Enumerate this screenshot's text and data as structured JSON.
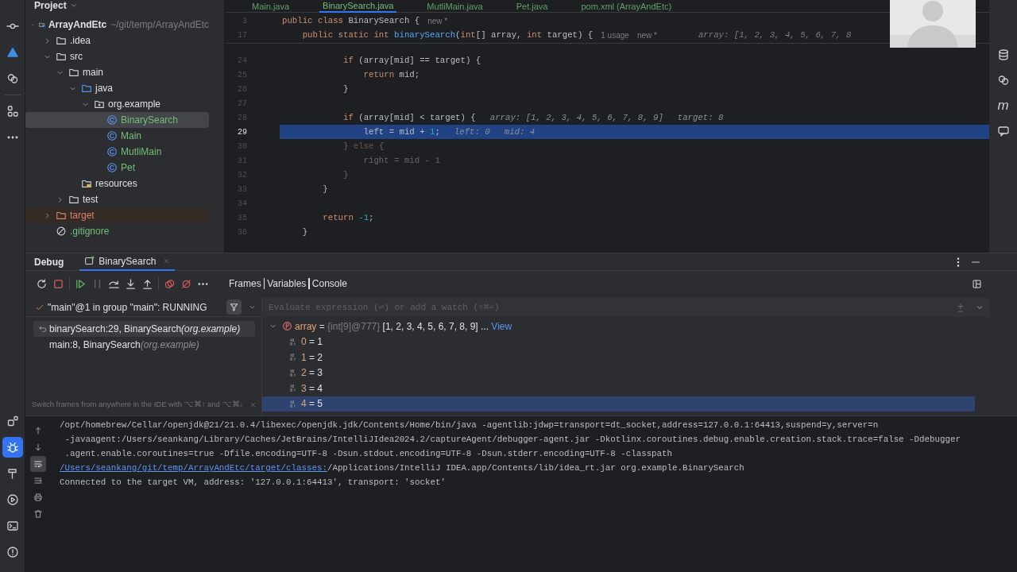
{
  "left_toolbar": {
    "top": [
      {
        "kind": "commit",
        "selected": false
      },
      {
        "kind": "triangle",
        "selected": false
      },
      {
        "kind": "circles",
        "selected": false
      },
      {
        "kind": "squares",
        "selected": false
      },
      {
        "kind": "more",
        "selected": false
      }
    ],
    "bottom": [
      {
        "kind": "plugins",
        "selected": false
      },
      {
        "kind": "bug",
        "selected": true
      },
      {
        "kind": "hammer",
        "selected": false
      },
      {
        "kind": "play",
        "selected": false
      },
      {
        "kind": "terminal",
        "selected": false
      },
      {
        "kind": "warning",
        "selected": false
      }
    ]
  },
  "project": {
    "title": "Project",
    "tree": [
      {
        "label": "ArrayAndEtc",
        "hint": "~/git/temp/ArrayAndEtc",
        "kind": "module",
        "color": "#dfe1e5",
        "selected": false,
        "expanded": true,
        "children": [
          {
            "label": ".idea",
            "kind": "folder",
            "color": "#dfe1e5",
            "selected": false,
            "expanded": false
          },
          {
            "label": "src",
            "kind": "folder",
            "color": "#dfe1e5",
            "selected": false,
            "expanded": true,
            "children": [
              {
                "label": "main",
                "kind": "folder",
                "color": "#dfe1e5",
                "selected": false,
                "expanded": true,
                "children": [
                  {
                    "label": "java",
                    "kind": "source",
                    "color": "#dfe1e5",
                    "selected": false,
                    "expanded": true,
                    "children": [
                      {
                        "label": "org.example",
                        "kind": "package",
                        "color": "#dfe1e5",
                        "selected": false,
                        "expanded": true,
                        "children": [
                          {
                            "label": "BinarySearch",
                            "kind": "class",
                            "color": "#73bd79",
                            "selected": true
                          },
                          {
                            "label": "Main",
                            "kind": "class",
                            "color": "#73bd79",
                            "selected": false
                          },
                          {
                            "label": "MutliMain",
                            "kind": "class",
                            "color": "#73bd79",
                            "selected": false
                          },
                          {
                            "label": "Pet",
                            "kind": "class",
                            "color": "#73bd79",
                            "selected": false
                          }
                        ]
                      }
                    ]
                  },
                  {
                    "label": "resources",
                    "kind": "resources",
                    "color": "#dfe1e5",
                    "selected": false
                  }
                ]
              },
              {
                "label": "test",
                "kind": "folder",
                "color": "#dfe1e5",
                "selected": false,
                "expanded": false
              }
            ]
          },
          {
            "label": "target",
            "kind": "excluded",
            "color": "#d9826a",
            "selected": false,
            "expanded": false
          },
          {
            "label": ".gitignore",
            "kind": "ignore",
            "color": "#73bd79",
            "selected": false
          }
        ]
      }
    ]
  },
  "editor": {
    "tabs": [
      {
        "label": "Main.java",
        "selected": false
      },
      {
        "label": "BinarySearch.java",
        "selected": true
      },
      {
        "label": "MutliMain.java",
        "selected": false
      },
      {
        "label": "Pet.java",
        "selected": false
      },
      {
        "label": "pom.xml (ArrayAndEtc)",
        "selected": false
      }
    ],
    "sticky_lines": [
      {
        "number": "3",
        "segments": [
          {
            "kind": "kw",
            "text": "public class "
          },
          {
            "kind": "plain",
            "text": "BinarySearch {"
          }
        ],
        "hints": [
          {
            "kind": "usage",
            "text": "new *"
          }
        ]
      },
      {
        "number": "17",
        "segments": [
          {
            "kind": "kw",
            "text": "    public static int "
          },
          {
            "kind": "fn",
            "text": "binarySearch"
          },
          {
            "kind": "plain",
            "text": "("
          },
          {
            "kind": "kw",
            "text": "int"
          },
          {
            "kind": "plain",
            "text": "[] array, "
          },
          {
            "kind": "kw",
            "text": "int "
          },
          {
            "kind": "plain",
            "text": "target) {"
          }
        ],
        "hints": [
          {
            "kind": "usage",
            "text": "1 usage"
          },
          {
            "kind": "usage",
            "text": "new *"
          },
          {
            "kind": "far",
            "text": "array: [1, 2, 3, 4, 5, 6, 7, 8"
          }
        ]
      }
    ],
    "lines": [
      {
        "number": "24",
        "current": false,
        "dimmed": false,
        "segments": [
          {
            "kind": "kw",
            "text": "            if "
          },
          {
            "kind": "plain",
            "text": "(array[mid] == target) {"
          }
        ]
      },
      {
        "number": "25",
        "current": false,
        "dimmed": false,
        "segments": [
          {
            "kind": "kw",
            "text": "                return "
          },
          {
            "kind": "plain",
            "text": "mid;"
          }
        ]
      },
      {
        "number": "26",
        "current": false,
        "dimmed": false,
        "segments": [
          {
            "kind": "plain",
            "text": "            }"
          }
        ]
      },
      {
        "number": "27",
        "current": false
      },
      {
        "number": "28",
        "current": false,
        "dimmed": false,
        "segments": [
          {
            "kind": "kw",
            "text": "            if "
          },
          {
            "kind": "plain",
            "text": "(array[mid] < target) {"
          }
        ],
        "hints": [
          {
            "kind": "value",
            "text": "array: [1, 2, 3, 4, 5, 6, 7, 8, 9]"
          },
          {
            "kind": "value",
            "text": "target: 8"
          }
        ]
      },
      {
        "number": "29",
        "current": true,
        "dimmed": false,
        "segments": [
          {
            "kind": "plain",
            "text": "                left = mid + "
          },
          {
            "kind": "num",
            "text": "1"
          },
          {
            "kind": "plain",
            "text": ";"
          }
        ],
        "hints": [
          {
            "kind": "value",
            "text": "left: 0"
          },
          {
            "kind": "value",
            "text": "mid: 4"
          }
        ]
      },
      {
        "number": "30",
        "current": false,
        "dimmed": true,
        "segments": [
          {
            "kind": "plain",
            "text": "            } "
          },
          {
            "kind": "kw",
            "text": "else "
          },
          {
            "kind": "plain",
            "text": "{"
          }
        ]
      },
      {
        "number": "31",
        "current": false,
        "dimmed": true,
        "segments": [
          {
            "kind": "plain",
            "text": "                right = mid - 1"
          }
        ]
      },
      {
        "number": "32",
        "current": false,
        "dimmed": true,
        "segments": [
          {
            "kind": "plain",
            "text": "            }"
          }
        ]
      },
      {
        "number": "33",
        "current": false,
        "dimmed": false,
        "segments": [
          {
            "kind": "plain",
            "text": "        }"
          }
        ]
      },
      {
        "number": "34",
        "current": false
      },
      {
        "number": "35",
        "current": false,
        "dimmed": false,
        "segments": [
          {
            "kind": "kw",
            "text": "        return "
          },
          {
            "kind": "num",
            "text": "-1"
          },
          {
            "kind": "plain",
            "text": ";"
          }
        ]
      },
      {
        "number": "36",
        "current": false,
        "dimmed": false,
        "segments": [
          {
            "kind": "plain",
            "text": "    }"
          }
        ]
      }
    ]
  },
  "right_toolbar": [
    {
      "kind": "database"
    },
    {
      "kind": "assistant"
    },
    {
      "kind": "maven",
      "label": "m"
    },
    {
      "kind": "robot"
    }
  ],
  "debug": {
    "title": "Debug",
    "tabs": [
      {
        "label": "BinarySearch",
        "selected": true
      }
    ],
    "toolbar": [
      {
        "kind": "rerun",
        "disabled": false
      },
      {
        "kind": "stop",
        "disabled": false
      },
      {
        "kind": "resume",
        "disabled": false
      },
      {
        "kind": "pause",
        "disabled": true
      },
      {
        "kind": "step-over",
        "disabled": false
      },
      {
        "kind": "step-into",
        "disabled": false
      },
      {
        "kind": "step-out",
        "disabled": false
      },
      {
        "kind": "breakpoints",
        "disabled": false
      },
      {
        "kind": "mute",
        "disabled": false
      },
      {
        "kind": "more",
        "disabled": false
      }
    ],
    "view_tabs": [
      "Frames",
      "Variables",
      "Console"
    ],
    "thread": "\"main\"@1 in group \"main\": RUNNING",
    "frames": [
      {
        "method": "binarySearch:29, BinarySearch",
        "package": "(org.example)",
        "selected": true
      },
      {
        "method": "main:8, BinarySearch",
        "package": "(org.example)",
        "selected": false
      }
    ],
    "frames_hint": "Switch frames from anywhere in the IDE with ⌥⌘↑ and ⌥⌘↓",
    "evaluate": {
      "placeholder": "Evaluate expression (⏎) or add a watch (⇧⌘⏎)"
    },
    "variables": [
      {
        "name": "array",
        "op": "=",
        "type": "{int[9]@777}",
        "value": "[1, 2, 3, 4, 5, 6, 7, 8, 9]",
        "more": "...",
        "link": "View",
        "expanded": true,
        "selected": false,
        "children": [
          {
            "name": "0",
            "op": "=",
            "value": "1",
            "selected": false
          },
          {
            "name": "1",
            "op": "=",
            "value": "2",
            "selected": false
          },
          {
            "name": "2",
            "op": "=",
            "value": "3",
            "selected": false
          },
          {
            "name": "3",
            "op": "=",
            "value": "4",
            "selected": false
          },
          {
            "name": "4",
            "op": "=",
            "value": "5",
            "selected": true
          }
        ]
      }
    ]
  },
  "console": {
    "toolbar": [
      {
        "kind": "up",
        "selected": false
      },
      {
        "kind": "down",
        "selected": false
      },
      {
        "kind": "wrap",
        "selected": true
      },
      {
        "kind": "scroll-end",
        "selected": false
      },
      {
        "kind": "print",
        "selected": false
      },
      {
        "kind": "trash",
        "selected": false
      }
    ],
    "lines": [
      {
        "segments": [
          {
            "kind": "text",
            "text": "/opt/homebrew/Cellar/openjdk@21/21.0.4/libexec/openjdk.jdk/Contents/Home/bin/java -agentlib:jdwp=transport=dt_socket,address=127.0.0.1:64413,suspend=y,server=n"
          }
        ]
      },
      {
        "segments": [
          {
            "kind": "text",
            "text": " -javaagent:/Users/seankang/Library/Caches/JetBrains/IntelliJIdea2024.2/captureAgent/debugger-agent.jar -Dkotlinx.coroutines.debug.enable.creation.stack.trace=false -Ddebugger"
          }
        ]
      },
      {
        "segments": [
          {
            "kind": "text",
            "text": " .agent.enable.coroutines=true -Dfile.encoding=UTF-8 -Dsun.stdout.encoding=UTF-8 -Dsun.stderr.encoding=UTF-8 -classpath"
          }
        ]
      },
      {
        "segments": [
          {
            "kind": "link",
            "text": " /Users/seankang/git/temp/ArrayAndEtc/target/classes:"
          },
          {
            "kind": "text",
            "text": "/Applications/IntelliJ IDEA.app/Contents/lib/idea_rt.jar org.example.BinarySearch"
          }
        ]
      },
      {
        "segments": [
          {
            "kind": "text",
            "text": "Connected to the target VM, address: '127.0.0.1:64413', transport: 'socket'"
          }
        ]
      }
    ]
  }
}
